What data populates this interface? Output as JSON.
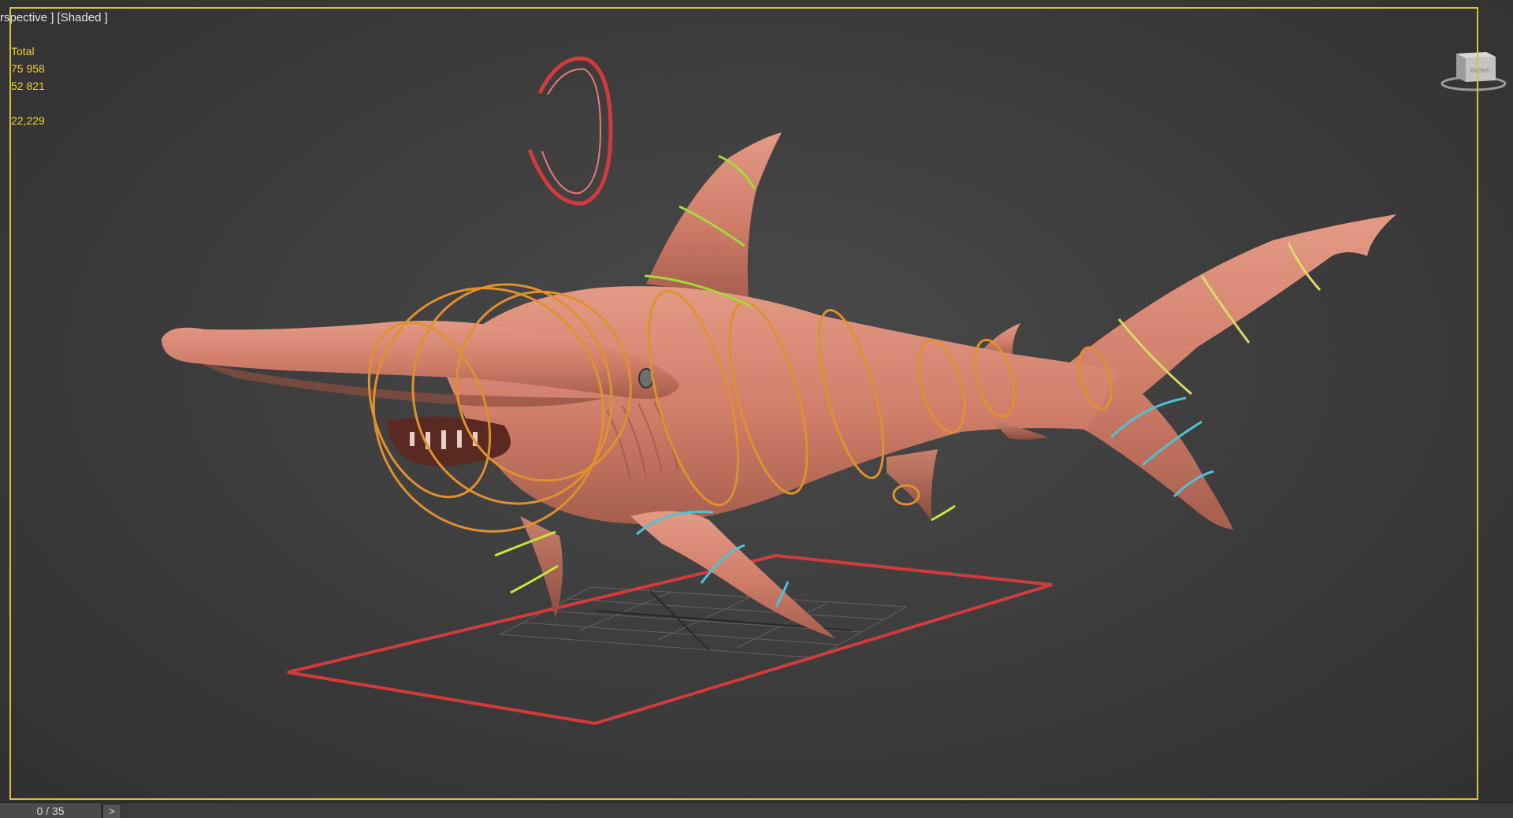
{
  "viewport": {
    "label": "rspective ] [Shaded ]",
    "stats": {
      "total_label": "Total",
      "polys": "75 958",
      "verts": "52 821",
      "fps": "22,229"
    },
    "viewcube_face": "FRONT"
  },
  "timeline": {
    "frame_counter": "0 / 35",
    "next_button": ">"
  },
  "colors": {
    "viewport_border": "#d8c23c",
    "stats_text": "#f0d030",
    "shark_skin": "#d38370",
    "spine_controls": "#e0902e",
    "fin_controls_green": "#a6d93a",
    "fin_controls_cyan": "#4fc3d8",
    "tail_controls": "#dada6a",
    "root_control": "#d23b3b"
  }
}
